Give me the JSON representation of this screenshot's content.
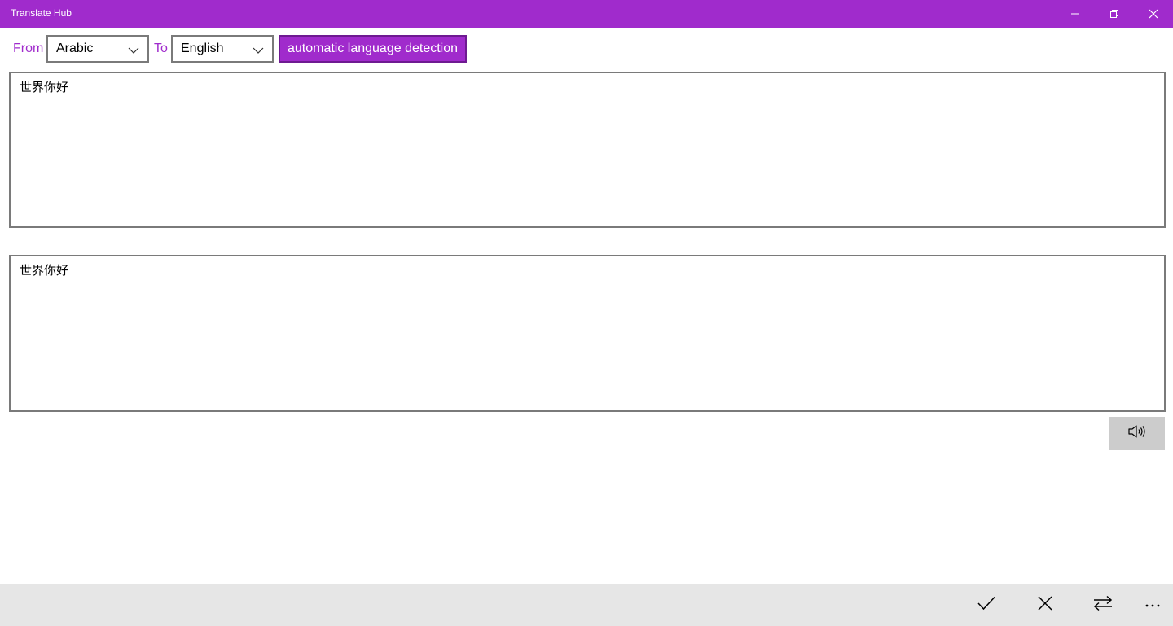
{
  "window": {
    "title": "Translate Hub",
    "controls": {
      "minimize_icon": "minimize-icon",
      "restore_icon": "restore-icon",
      "close_icon": "close-icon"
    }
  },
  "colors": {
    "accent": "#a02bcc",
    "accent_border": "#6e1a91",
    "command_bar": "#e6e6e6",
    "speak_button": "#cccccc"
  },
  "language_bar": {
    "from_label": "From",
    "from_value": "Arabic",
    "to_label": "To",
    "to_value": "English",
    "detect_label": "automatic language detection"
  },
  "source": {
    "text": "世界你好"
  },
  "result": {
    "text": "世界你好"
  },
  "speak": {
    "icon": "speaker-icon"
  },
  "command_bar": {
    "items": [
      {
        "icon": "checkmark-icon"
      },
      {
        "icon": "close-icon"
      },
      {
        "icon": "swap-icon"
      },
      {
        "icon": "more-icon"
      }
    ]
  }
}
